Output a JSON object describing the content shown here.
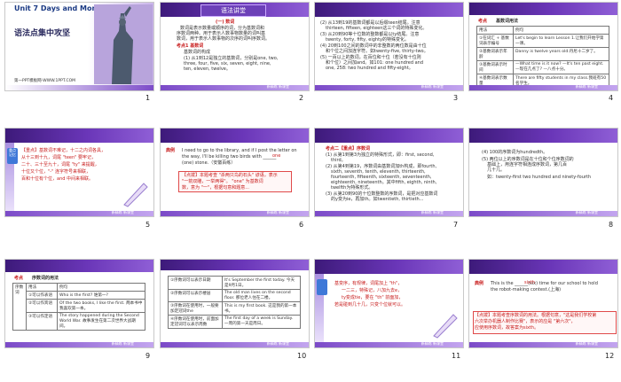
{
  "slides": [
    {
      "n": "1",
      "title": "Unit 7 Days and Months",
      "subtitle": "语法点集中攻坚",
      "footer": "第一PPT模板网-WWW.1PPT.COM"
    },
    {
      "n": "2",
      "header": "语法讲堂",
      "sec": "(一) 数词",
      "lines": [
        "数词是表示数量或顺序的词，分为基数词和",
        "序数词两种。用于表示人数事物数量的词叫基",
        "数词，用于表示人数事物的次序的词叫序数词。"
      ],
      "point": "考点1 基数词",
      "sub": "基数词的构成",
      "item": "(1) 从1到12是独立的基数词，分别是one, two,",
      "item2": "three, four, five, six, seven, eight, nine,",
      "item3": "ten, eleven, twelve。"
    },
    {
      "n": "3",
      "lines": [
        "(2) 从13到19的基数词都是以后缀teen结尾。注意",
        "thirteen, fifteen, eighteen这三个词的特殊变化。",
        "(3) 从20到90等十位数的整数都是以ty结尾。注意",
        "twenty, forty, fifty, eighty的特殊变化。",
        "(4) 20到100之间的数词中的非整数的两位数是由十位",
        "和个位之间加连字符。如twenty-five, thirty-two。",
        "(5) 一百以上的数词，在百位和十位（若没有十位则",
        "和个位）之间加and。如101: one hundred and",
        "one, 258: two hundred and fifty-eight。"
      ]
    },
    {
      "n": "4",
      "header": "考点",
      "headtitle": "基数词用法",
      "cols": [
        "用法",
        "例句"
      ],
      "rows": [
        [
          "①在词汇 + 基数词表示编号",
          "Let's begin to learn Lesson 1.让我们开始学第一课。"
        ],
        [
          "②基数词表示年龄",
          "Danny is twelve years old.丹尼十二岁了。"
        ],
        [
          "③基数词表示时间",
          "—What time is it now? —It's ten past eight. —现在几点了? —八点十分。"
        ],
        [
          "④基数词表示数量",
          "There are fifty students in my class.我班有50名学生。"
        ]
      ]
    },
    {
      "n": "5",
      "tag": "重点 记忆",
      "lines": [
        "【重点】基数词不难记，十二之内词各具，",
        "从十三到十九，词尾 \"teen\" 要牢记，",
        "二十、三十至九十，词尾 \"ty\" 来提醒，",
        "十位又个位，\"-\" 连字符号来相联，",
        "百和十位有个位，and 中间来相联。"
      ]
    },
    {
      "n": "6",
      "label": "典例",
      "lines": [
        "I need to go to the library, and if I post the letter on",
        "the way, I'll be killing two birds with ______",
        "(one) stone.（安徽百练）"
      ],
      "answer": "one",
      "note": [
        "【点拨】本题考查 \"杀两只鸟的石头\" 谚语，表示",
        "\"一箭双雕，一举两得\"。 \"one\" 为基数词",
        "数，意为 \"一\"，根据句意和题意..."
      ]
    },
    {
      "n": "7",
      "point": "考点二【重点】序数词",
      "lines": [
        "(1) 从第1到第3为独立的特殊形式，即：first, second,",
        "third。",
        "(2) 从第4到第19，序数词由基数词加th构成，即fourth,",
        "sixth, seventh, tenth, eleventh, thirteenth,",
        "fourteenth, fifteenth, sixteenth, seventeenth,",
        "eighteenth, nineteenth。其中fifth, eighth, ninth,",
        "twelfth为特殊形式。",
        "(3) 从第20到90的十位数整数的序数词，是把对应基数词",
        "的y变为ie，再加th。如twentieth, thirtieth..."
      ]
    },
    {
      "n": "8",
      "lines": [
        "(4) 100的序数词为hundredth。",
        "(5) 两位以上的序数词是在十位和个位序数词的",
        "基础上，用连字符相连成序数词，第几百",
        "几十几。",
        "如：twenty-first   two hundred and ninety-fourth"
      ]
    },
    {
      "n": "9",
      "header": "考点",
      "headtitle": "序数词的用法",
      "cols": [
        "用法",
        "例句"
      ],
      "side": "序数词",
      "rows": [
        [
          "①可以作表语",
          "Who is the first? 谁第一?"
        ],
        [
          "②可以作宾语",
          "Of the two books, I like the first. 两本书中我喜欢第一本。"
        ],
        [
          "③可以作定语",
          "The story happened during the Second World War. 故事发生在第二次世界大战期间。"
        ]
      ]
    },
    {
      "n": "10",
      "rows": [
        [
          "①序数词可以表示日期",
          "It's September the first today. 今天是9月1日。"
        ],
        [
          "②序数词可以表示楼层",
          "The old man lives on the second floor. 那位老人住在二楼。"
        ],
        [
          "③序数词在使用时，一般要加定冠词the",
          "This is my first book. 这是我的第一本书。"
        ],
        [
          "④序数词在使用时，前面加定冠词可以表示周数",
          "The first day of a week is Sunday. 一周的第一天是周日。"
        ]
      ]
    },
    {
      "n": "11",
      "heading": "【记忆】",
      "lines": [
        "基变序，有规律，词尾加上 \"th\"，",
        "一二三，特殊记，八加九去e，",
        "ty变成tie，要在 \"th\" 前面加，",
        "若是碰到几十几，只变个位就可以。"
      ]
    },
    {
      "n": "12",
      "label": "典例",
      "lines": [
        "This is the ______(six) time for our school to hold",
        "the robot-making contest.(上海)"
      ],
      "answer": "sixth",
      "note": [
        "【点拨】本题考查序数词的用法。根据句意，\"这是我们学校第",
        "六次举办机器人制作比赛\"，表示的应是 \"第六次\"，",
        "应使用序数词，故答案为sixth。"
      ]
    }
  ],
  "footer_text": "新精练 新课堂",
  "colors": {
    "topbar_dark": "#3d1a7a",
    "topbar_light": "#8f5fd6",
    "accent_red": "#c81d1d",
    "tag_blue": "#3e78d8"
  }
}
